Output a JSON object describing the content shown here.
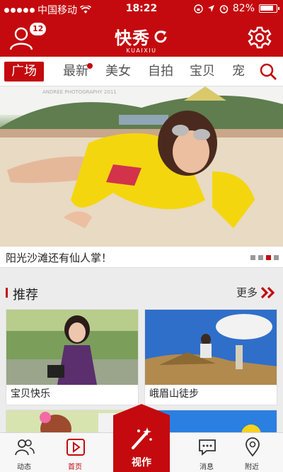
{
  "status": {
    "carrier": "中国移动",
    "time": "18:22",
    "battery": "82%"
  },
  "header": {
    "logo_cn": "快秀",
    "logo_en": "KUAIXIU",
    "notification_count": "12"
  },
  "tabs": [
    {
      "label": "广场",
      "active": true
    },
    {
      "label": "最新",
      "has_dot": true
    },
    {
      "label": "美女"
    },
    {
      "label": "自拍"
    },
    {
      "label": "宝贝"
    },
    {
      "label": "宠"
    }
  ],
  "banner": {
    "caption": "阳光沙滩还有仙人掌！",
    "watermark": "ANDREE PHOTOGRAPHY 2011",
    "page_count": 4,
    "active_page": 3
  },
  "recommend": {
    "title": "推荐",
    "more": "更多",
    "cards": [
      {
        "label": "宝贝快乐"
      },
      {
        "label": "峨眉山徒步"
      }
    ]
  },
  "nav": {
    "dynamics": "动态",
    "home": "首页",
    "center": "视作",
    "messages": "消息",
    "nearby": "附近"
  },
  "colors": {
    "brand": "#c40a0e"
  }
}
